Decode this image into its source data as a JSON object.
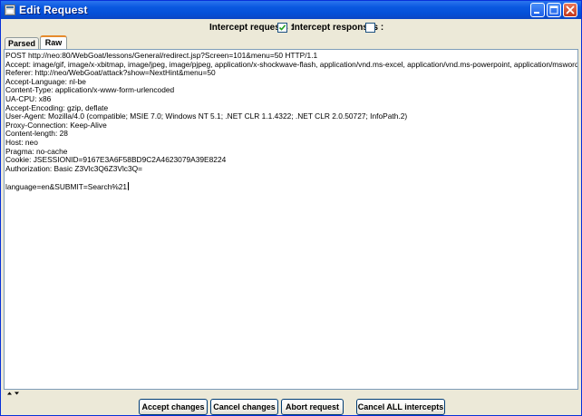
{
  "window": {
    "title": "Edit Request"
  },
  "topbar": {
    "intercept_requests_label": "Intercept requests :",
    "intercept_requests_checked": true,
    "intercept_responses_label": "Intercept responses :",
    "intercept_responses_checked": false
  },
  "tabs": [
    {
      "label": "Parsed",
      "active": false
    },
    {
      "label": "Raw",
      "active": true
    }
  ],
  "request_lines": [
    "POST http://neo:80/WebGoat/lessons/General/redirect.jsp?Screen=101&menu=50 HTTP/1.1",
    "Accept: image/gif, image/x-xbitmap, image/jpeg, image/pjpeg, application/x-shockwave-flash, application/vnd.ms-excel, application/vnd.ms-powerpoint, application/msword, */*",
    "Referer: http://neo/WebGoat/attack?show=NextHint&menu=50",
    "Accept-Language: nl-be",
    "Content-Type: application/x-www-form-urlencoded",
    "UA-CPU: x86",
    "Accept-Encoding: gzip, deflate",
    "User-Agent: Mozilla/4.0 (compatible; MSIE 7.0; Windows NT 5.1; .NET CLR 1.1.4322; .NET CLR 2.0.50727; InfoPath.2)",
    "Proxy-Connection: Keep-Alive",
    "Content-length: 28",
    "Host: neo",
    "Pragma: no-cache",
    "Cookie: JSESSIONID=9167E3A6F58BD9C2A4623079A39E8224",
    "Authorization: Basic Z3Vlc3Q6Z3Vlc3Q=",
    "",
    "language=en&SUBMIT=Search%21"
  ],
  "buttons": {
    "accept": "Accept changes",
    "cancel": "Cancel changes",
    "abort": "Abort request",
    "cancel_all": "Cancel ALL intercepts"
  },
  "icons": {
    "title": "edit-request-window-icon",
    "minimize": "minimize-icon",
    "maximize": "maximize-icon",
    "close": "close-icon",
    "checkmark": "checkmark-icon",
    "splitter": "splitter-arrows-icon"
  },
  "colors": {
    "titlebar": "#0a58e0",
    "tab_accent": "#e68b2c",
    "window_bg": "#ece9d8",
    "close_button": "#c3361a"
  }
}
